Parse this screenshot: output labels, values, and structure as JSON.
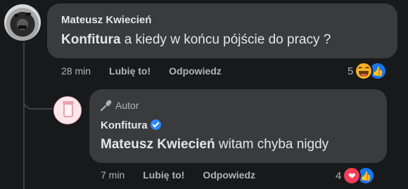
{
  "comment": {
    "author": "Mateusz Kwiecień",
    "mention": "Konfitura",
    "text": " a kiedy w końcu pójście do pracy ?",
    "time": "28 min",
    "like_label": "Lubię to!",
    "reply_label": "Odpowiedz",
    "reaction_count": "5",
    "reaction_icons": [
      "haha-icon",
      "like-icon"
    ]
  },
  "reply": {
    "badge_label": "Autor",
    "badge_icon": "microphone-icon",
    "author": "Konfitura",
    "verified": true,
    "mention": "Mateusz Kwiecień",
    "text": " witam chyba nigdy",
    "time": "7 min",
    "like_label": "Lubię to!",
    "reply_label": "Odpowiedz",
    "reaction_count": "4",
    "reaction_icons": [
      "love-icon",
      "like-icon"
    ]
  },
  "colors": {
    "background": "#18191a",
    "bubble": "#3a3b3c",
    "text_primary": "#e4e6eb",
    "text_secondary": "#b0b3b8",
    "like_blue": "#1877f2",
    "love_red": "#f33e58",
    "haha_yellow": "#f7b125",
    "verified_blue": "#2d88ff"
  }
}
